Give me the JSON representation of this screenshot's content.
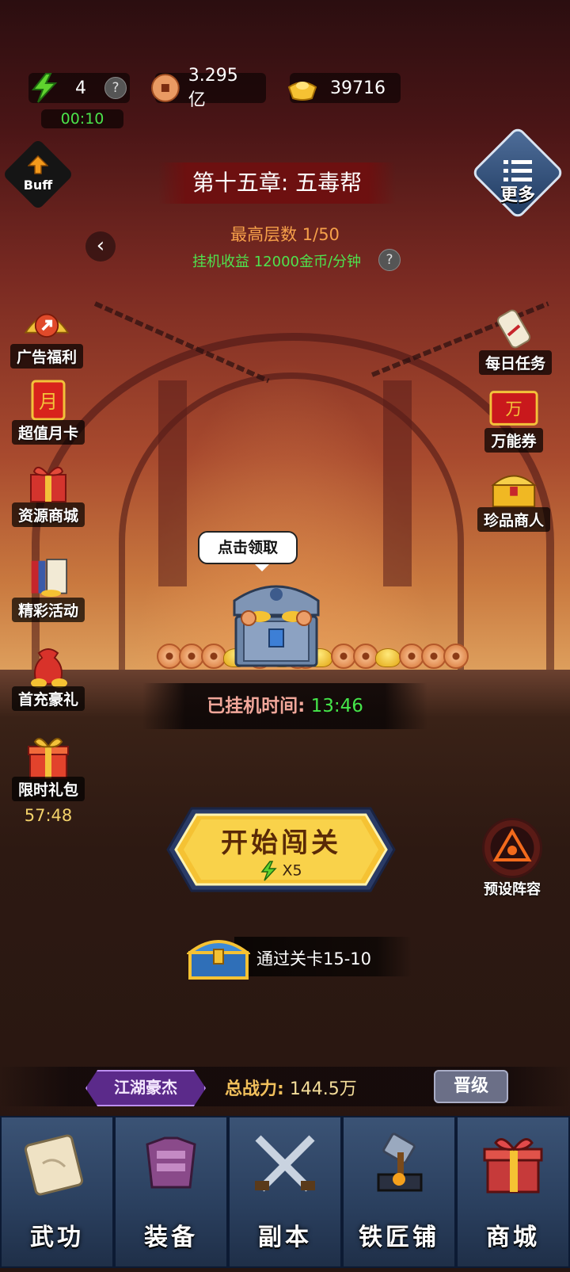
{
  "top_bar": {
    "stamina": {
      "icon": "lightning-icon",
      "value": "4",
      "help": "?",
      "timer": "00:10"
    },
    "copper": {
      "icon": "copper-coin-icon",
      "value": "3.295亿"
    },
    "gold": {
      "icon": "gold-ingot-icon",
      "value": "39716"
    }
  },
  "buff": {
    "label": "Buff"
  },
  "more": {
    "label": "更多"
  },
  "chapter": {
    "title": "第十五章: 五毒帮",
    "max_floor": "最高层数 1/50",
    "idle_income": "挂机收益 12000金币/分钟",
    "help": "?"
  },
  "left_menu": [
    {
      "label": "广告福利"
    },
    {
      "label": "超值月卡",
      "icon_text": "月"
    },
    {
      "label": "资源商城"
    },
    {
      "label": "精彩活动"
    },
    {
      "label": "首充豪礼"
    },
    {
      "label": "限时礼包",
      "timer": "57:48"
    }
  ],
  "right_menu": [
    {
      "label": "每日任务"
    },
    {
      "label": "万能券",
      "icon_text": "万"
    },
    {
      "label": "珍品商人"
    }
  ],
  "idle_reward": {
    "bubble": "点击领取",
    "time_label": "已挂机时间:",
    "time_value": "13:46"
  },
  "start": {
    "label": "开始闯关",
    "cost": "X5"
  },
  "preset": {
    "label": "预设阵容"
  },
  "stage_goal": {
    "text": "通过关卡15-10"
  },
  "status": {
    "rank": "江湖豪杰",
    "power_label": "总战力:",
    "power_value": "144.5万",
    "upgrade": "晋级"
  },
  "bottom_nav": [
    {
      "label": "武功",
      "icon": "scroll-icon"
    },
    {
      "label": "装备",
      "icon": "armor-icon"
    },
    {
      "label": "副本",
      "icon": "crossed-swords-icon"
    },
    {
      "label": "铁匠铺",
      "icon": "hammer-anvil-icon"
    },
    {
      "label": "商城",
      "icon": "gift-box-icon"
    }
  ],
  "colors": {
    "green_text": "#4ee34e",
    "orange_text": "#f6a04a",
    "nav_bg": "#2a3f5e",
    "button_gold": "#f5c233"
  }
}
